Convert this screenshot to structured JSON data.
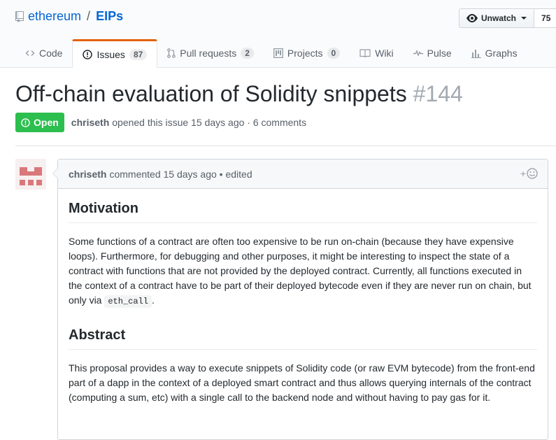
{
  "repo": {
    "owner": "ethereum",
    "separator": "/",
    "name": "EIPs"
  },
  "watch": {
    "label": "Unwatch",
    "count": "75"
  },
  "tabs": [
    {
      "label": "Code",
      "icon": "code-icon"
    },
    {
      "label": "Issues",
      "count": "87",
      "icon": "issue-opened-icon"
    },
    {
      "label": "Pull requests",
      "count": "2",
      "icon": "git-pull-request-icon"
    },
    {
      "label": "Projects",
      "count": "0",
      "icon": "project-icon"
    },
    {
      "label": "Wiki",
      "icon": "book-icon"
    },
    {
      "label": "Pulse",
      "icon": "pulse-icon"
    },
    {
      "label": "Graphs",
      "icon": "graph-icon"
    }
  ],
  "issue": {
    "title": "Off-chain evaluation of Solidity snippets",
    "number": "#144",
    "state": "Open",
    "author": "chriseth",
    "meta": "opened this issue 15 days ago · 6 comments"
  },
  "comment": {
    "author": "chriseth",
    "meta": "commented 15 days ago • edited",
    "reaction": "+",
    "h1": "Motivation",
    "p1": "Some functions of a contract are often too expensive to be run on-chain (because they have expensive loops). Furthermore, for debugging and other purposes, it might be interesting to inspect the state of a contract with functions that are not provided by the deployed contract. Currently, all functions executed in the context of a contract have to be part of their deployed bytecode even if they are never run on chain, but only via ",
    "p1_code": "eth_call",
    "p1_end": ".",
    "h2": "Abstract",
    "p2": "This proposal provides a way to execute snippets of Solidity code (or raw EVM bytecode) from the front-end part of a dapp in the context of a deployed smart contract and thus allows querying internals of the contract (computing a sum, etc) with a single call to the backend node and without having to pay gas for it."
  },
  "colors": {
    "open": "#2cbe4e",
    "link": "#0366d6",
    "tab_accent": "#e36209",
    "avatar": "#d9787a"
  }
}
